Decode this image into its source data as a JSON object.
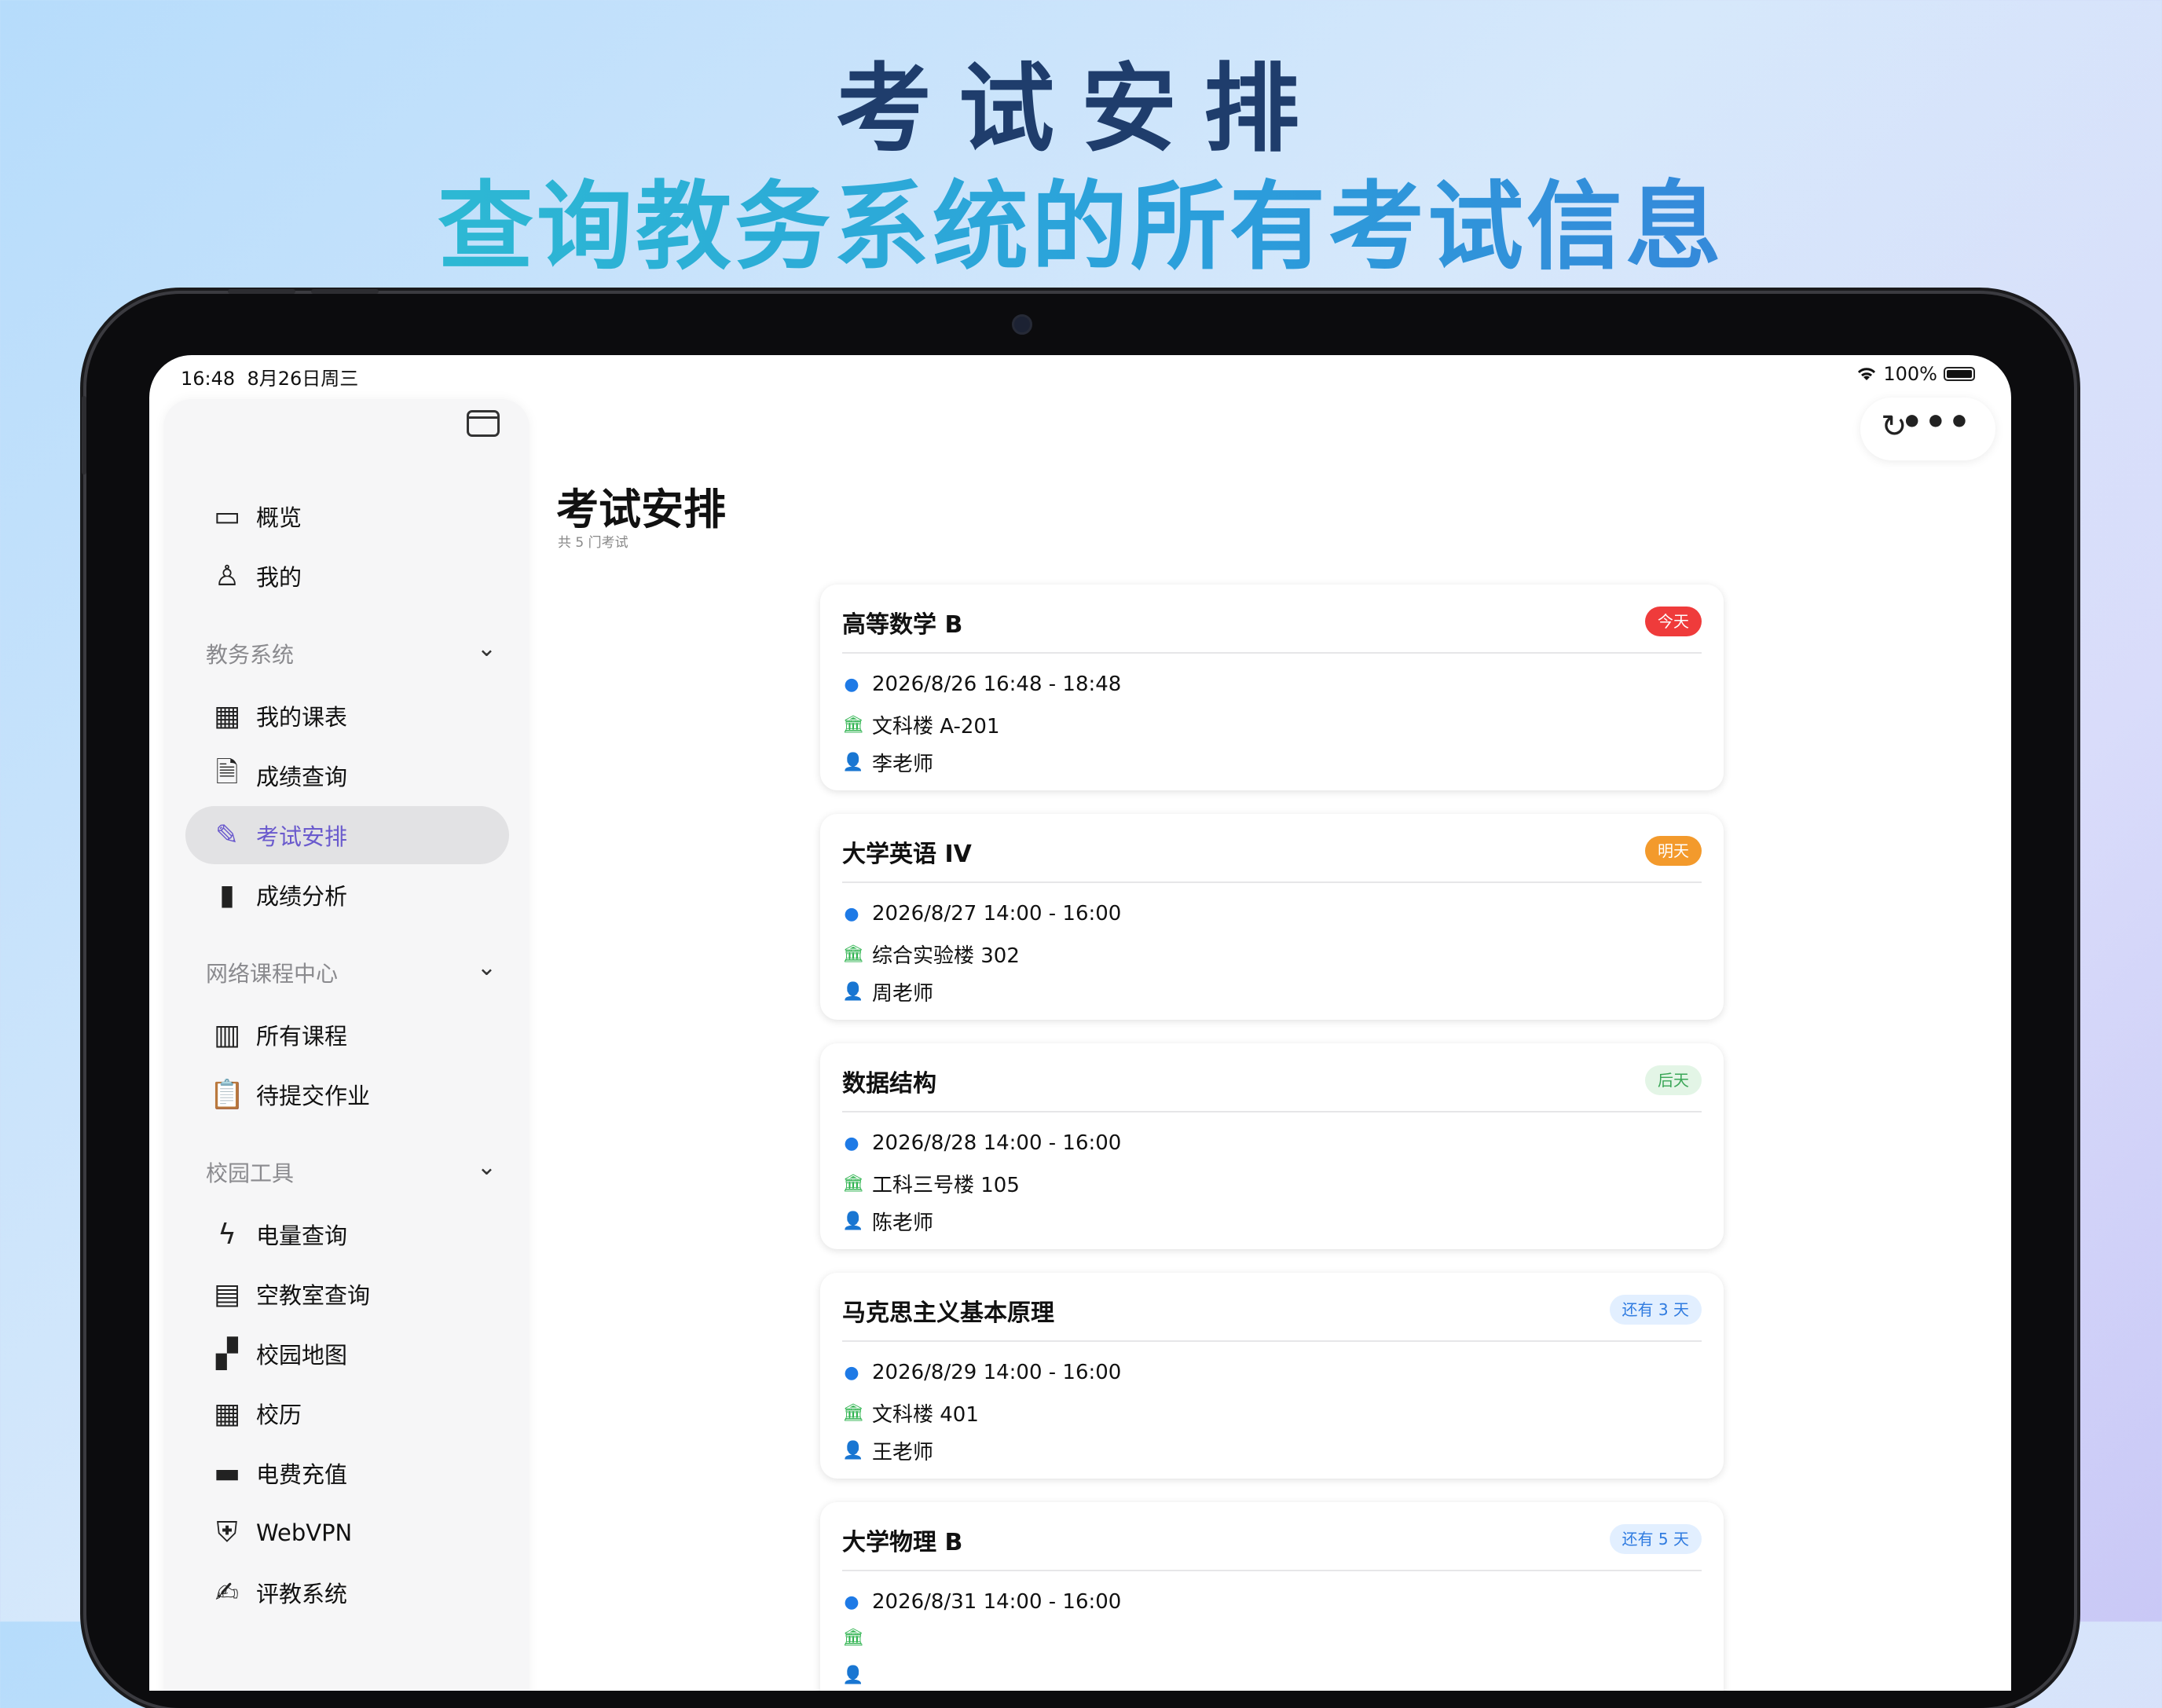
{
  "hero": {
    "title": "考试安排",
    "subtitle": "查询教务系统的所有考试信息"
  },
  "status_bar": {
    "time": "16:48",
    "date": "8月26日周三",
    "wifi_icon": "wifi-icon",
    "battery_percent": "100%",
    "battery_level": 1.0
  },
  "toolbar": {
    "refresh_icon": "refresh-icon",
    "more_icon": "more-icon",
    "more_glyph": "•••",
    "refresh_glyph": "↻"
  },
  "sidebar": {
    "toggle_icon": "sidebar-toggle-icon",
    "top_items": [
      {
        "label": "概览",
        "icon": "cards-icon",
        "glyph": "▭"
      },
      {
        "label": "我的",
        "icon": "person-icon",
        "glyph": "♙"
      }
    ],
    "sections": [
      {
        "title": "教务系统",
        "items": [
          {
            "label": "我的课表",
            "icon": "calendar-grid-icon",
            "glyph": "▦"
          },
          {
            "label": "成绩查询",
            "icon": "doc-search-icon",
            "glyph": "🗎"
          },
          {
            "label": "考试安排",
            "icon": "pencil-circle-icon",
            "glyph": "✎",
            "active": true
          },
          {
            "label": "成绩分析",
            "icon": "bar-chart-icon",
            "glyph": "▮"
          }
        ]
      },
      {
        "title": "网络课程中心",
        "items": [
          {
            "label": "所有课程",
            "icon": "books-icon",
            "glyph": "▥"
          },
          {
            "label": "待提交作业",
            "icon": "clipboard-icon",
            "glyph": "📋"
          }
        ]
      },
      {
        "title": "校园工具",
        "items": [
          {
            "label": "电量查询",
            "icon": "bolt-icon",
            "glyph": "ϟ"
          },
          {
            "label": "空教室查询",
            "icon": "building-icon",
            "glyph": "▤"
          },
          {
            "label": "校园地图",
            "icon": "map-icon",
            "glyph": "▞"
          },
          {
            "label": "校历",
            "icon": "calendar-clock-icon",
            "glyph": "▦"
          },
          {
            "label": "电费充值",
            "icon": "card-icon",
            "glyph": "▬"
          },
          {
            "label": "WebVPN",
            "icon": "shield-lock-icon",
            "glyph": "⛨"
          },
          {
            "label": "评教系统",
            "icon": "edit-doc-icon",
            "glyph": "✍"
          }
        ]
      }
    ],
    "chevron_glyph": "⌄"
  },
  "main": {
    "title": "考试安排",
    "subtitle": "共 5 门考试",
    "exams": [
      {
        "name": "高等数学 B",
        "badge": "今天",
        "badge_bg": "#ef3b3b",
        "badge_fg": "#ffffff",
        "time": "2026/8/26 16:48 - 18:48",
        "place": "文科楼 A-201",
        "teacher": "李老师"
      },
      {
        "name": "大学英语 IV",
        "badge": "明天",
        "badge_bg": "#f39a2c",
        "badge_fg": "#ffffff",
        "time": "2026/8/27 14:00 - 16:00",
        "place": "综合实验楼 302",
        "teacher": "周老师"
      },
      {
        "name": "数据结构",
        "badge": "后天",
        "badge_bg": "#e3f5e6",
        "badge_fg": "#3aa657",
        "time": "2026/8/28 14:00 - 16:00",
        "place": "工科三号楼 105",
        "teacher": "陈老师"
      },
      {
        "name": "马克思主义基本原理",
        "badge": "还有 3 天",
        "badge_bg": "#e2efff",
        "badge_fg": "#2f7be0",
        "time": "2026/8/29 14:00 - 16:00",
        "place": "文科楼 401",
        "teacher": "王老师"
      },
      {
        "name": "大学物理 B",
        "badge": "还有 5 天",
        "badge_bg": "#e2efff",
        "badge_fg": "#2f7be0",
        "time": "2026/8/31 14:00 - 16:00",
        "place": "",
        "teacher": ""
      }
    ],
    "row_icons": {
      "time": "clock-icon",
      "place": "building-columns-icon",
      "teacher": "person-icon"
    }
  }
}
